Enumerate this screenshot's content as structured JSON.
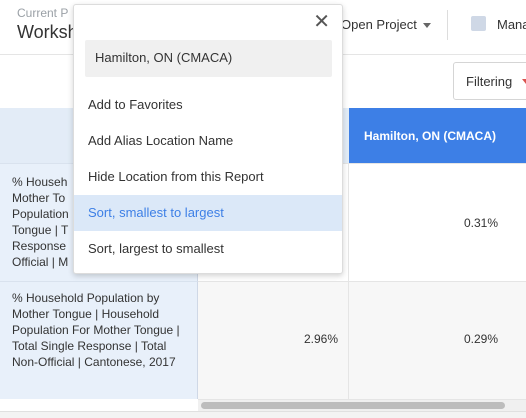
{
  "header": {
    "crumb_small": "Current P",
    "crumb_title": "Worksh",
    "open_project": "Open Project",
    "manage": "Mana"
  },
  "toolbar": {
    "filtering": "Filtering"
  },
  "table": {
    "column_header": "Hamilton, ON (CMACA)",
    "rows": [
      {
        "label": "% Househ\nMother To\nPopulation\nTongue | T\nResponse\nOfficial | M",
        "mid_value": "",
        "right_value": "0.31%"
      },
      {
        "label": "% Household Population by Mother Tongue | Household Population For Mother Tongue | Total Single Response | Total Non-Official | Cantonese, 2017",
        "mid_value": "2.96%",
        "right_value": "0.29%"
      }
    ]
  },
  "popup": {
    "location": "Hamilton, ON (CMACA)",
    "items": [
      "Add to Favorites",
      "Add Alias Location Name",
      "Hide Location from this Report",
      "Sort, smallest to largest",
      "Sort, largest to smallest"
    ]
  },
  "colors": {
    "accent": "#3d7fe6",
    "active_item_bg": "#dbe8f8",
    "row_label_bg": "#e8f0fa"
  }
}
